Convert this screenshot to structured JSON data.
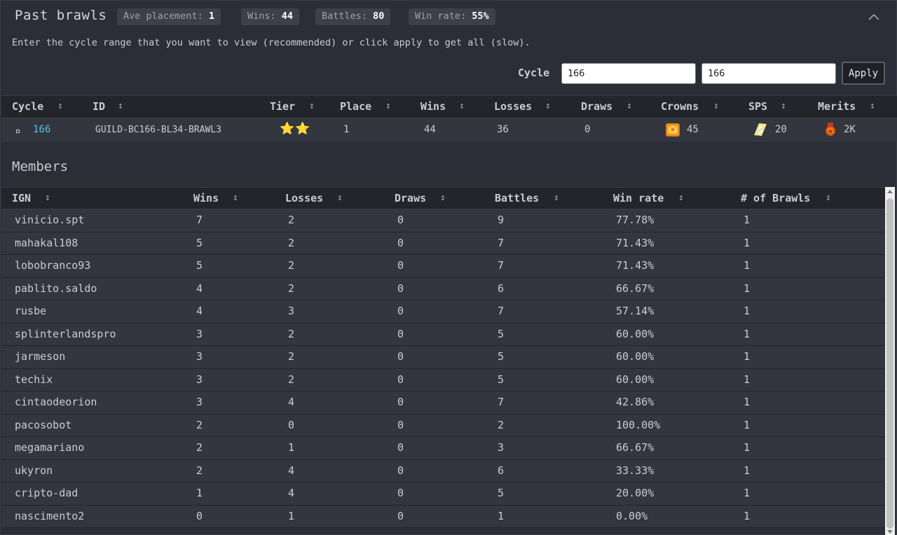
{
  "header": {
    "title": "Past brawls",
    "badges": [
      {
        "label": "Ave placement:",
        "value": "1"
      },
      {
        "label": "Wins:",
        "value": "44"
      },
      {
        "label": "Battles:",
        "value": "80"
      },
      {
        "label": "Win rate:",
        "value": "55%"
      }
    ]
  },
  "hint": "Enter the cycle range that you want to view (recommended) or click apply to get all (slow).",
  "cycle_filter": {
    "label": "Cycle",
    "from_value": "166",
    "to_value": "166",
    "apply_label": "Apply"
  },
  "brawl_table": {
    "columns": [
      "Cycle",
      "ID",
      "Tier",
      "Place",
      "Wins",
      "Losses",
      "Draws",
      "Crowns",
      "SPS",
      "Merits"
    ],
    "sort_icon": "↕",
    "row": {
      "cycle": "166",
      "id": "GUILD-BC166-BL34-BRAWL3",
      "tier_stars": "⭐⭐",
      "place": "1",
      "wins": "44",
      "losses": "36",
      "draws": "0",
      "crowns": "45",
      "sps": "20",
      "merits": "2K"
    }
  },
  "members": {
    "title": "Members",
    "columns": [
      "IGN",
      "Wins",
      "Losses",
      "Draws",
      "Battles",
      "Win rate",
      "# of Brawls"
    ],
    "rows": [
      [
        "vinicio.spt",
        "7",
        "2",
        "0",
        "9",
        "77.78%",
        "1"
      ],
      [
        "mahakal108",
        "5",
        "2",
        "0",
        "7",
        "71.43%",
        "1"
      ],
      [
        "lobobranco93",
        "5",
        "2",
        "0",
        "7",
        "71.43%",
        "1"
      ],
      [
        "pablito.saldo",
        "4",
        "2",
        "0",
        "6",
        "66.67%",
        "1"
      ],
      [
        "rusbe",
        "4",
        "3",
        "0",
        "7",
        "57.14%",
        "1"
      ],
      [
        "splinterlandspro",
        "3",
        "2",
        "0",
        "5",
        "60.00%",
        "1"
      ],
      [
        "jarmeson",
        "3",
        "2",
        "0",
        "5",
        "60.00%",
        "1"
      ],
      [
        "techix",
        "3",
        "2",
        "0",
        "5",
        "60.00%",
        "1"
      ],
      [
        "cintaodeorion",
        "3",
        "4",
        "0",
        "7",
        "42.86%",
        "1"
      ],
      [
        "pacosobot",
        "2",
        "0",
        "0",
        "2",
        "100.00%",
        "1"
      ],
      [
        "megamariano",
        "2",
        "1",
        "0",
        "3",
        "66.67%",
        "1"
      ],
      [
        "ukyron",
        "2",
        "4",
        "0",
        "6",
        "33.33%",
        "1"
      ],
      [
        "cripto-dad",
        "1",
        "4",
        "0",
        "5",
        "20.00%",
        "1"
      ],
      [
        "nascimento2",
        "0",
        "1",
        "0",
        "1",
        "0.00%",
        "1"
      ]
    ]
  }
}
